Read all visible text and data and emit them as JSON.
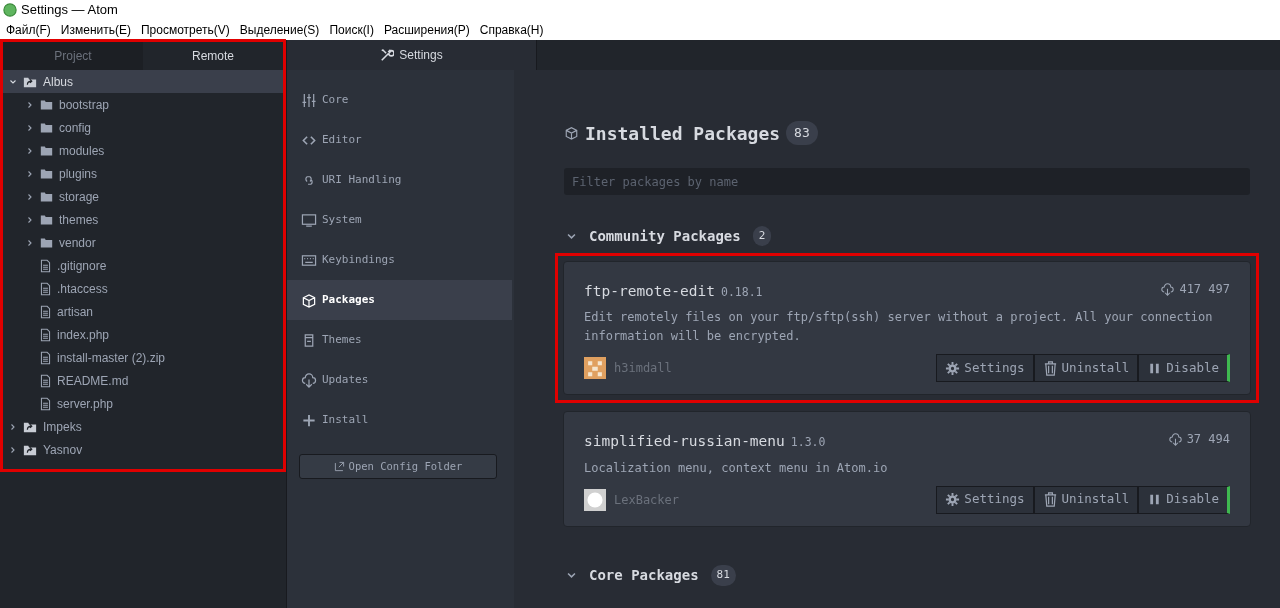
{
  "window": {
    "title": "Settings — Atom"
  },
  "menu": [
    "Файл(F)",
    "Изменить(E)",
    "Просмотреть(V)",
    "Выделение(S)",
    "Поиск(I)",
    "Расширения(P)",
    "Справка(H)"
  ],
  "tree_panel": {
    "highlighted": true,
    "tabs": [
      {
        "label": "Project",
        "selected": false
      },
      {
        "label": "Remote",
        "selected": true
      }
    ],
    "items": [
      {
        "name": "Albus",
        "kind": "project",
        "expanded": true,
        "selected": true,
        "children": [
          {
            "name": "bootstrap",
            "kind": "folder",
            "expanded": false,
            "selected": false
          },
          {
            "name": "config",
            "kind": "folder",
            "expanded": false,
            "selected": false
          },
          {
            "name": "modules",
            "kind": "folder",
            "expanded": false,
            "selected": false
          },
          {
            "name": "plugins",
            "kind": "folder",
            "expanded": false,
            "selected": false
          },
          {
            "name": "storage",
            "kind": "folder",
            "expanded": false,
            "selected": false
          },
          {
            "name": "themes",
            "kind": "folder",
            "expanded": false,
            "selected": false
          },
          {
            "name": "vendor",
            "kind": "folder",
            "expanded": false,
            "selected": false
          },
          {
            "name": ".gitignore",
            "kind": "file",
            "selected": false
          },
          {
            "name": ".htaccess",
            "kind": "file",
            "selected": false
          },
          {
            "name": "artisan",
            "kind": "file",
            "selected": false
          },
          {
            "name": "index.php",
            "kind": "file",
            "selected": false
          },
          {
            "name": "install-master (2).zip",
            "kind": "file",
            "selected": false
          },
          {
            "name": "README.md",
            "kind": "file",
            "selected": false
          },
          {
            "name": "server.php",
            "kind": "file",
            "selected": false
          }
        ]
      },
      {
        "name": "Impeks",
        "kind": "project",
        "expanded": false,
        "selected": false
      },
      {
        "name": "Yasnov",
        "kind": "project",
        "expanded": false,
        "selected": false
      }
    ]
  },
  "editor_tab": {
    "label": "Settings"
  },
  "settings_nav": {
    "items": [
      {
        "label": "Core",
        "selected": false
      },
      {
        "label": "Editor",
        "selected": false
      },
      {
        "label": "URI Handling",
        "selected": false
      },
      {
        "label": "System",
        "selected": false
      },
      {
        "label": "Keybindings",
        "selected": false
      },
      {
        "label": "Packages",
        "selected": true
      },
      {
        "label": "Themes",
        "selected": false
      },
      {
        "label": "Updates",
        "selected": false
      },
      {
        "label": "Install",
        "selected": false
      }
    ],
    "button": "Open Config Folder"
  },
  "installed": {
    "title": "Installed Packages",
    "count": "83",
    "filter_placeholder": "Filter packages by name"
  },
  "sections": [
    {
      "title": "Community Packages",
      "count": "2",
      "expanded": true,
      "packages": [
        {
          "name": "ftp-remote-edit",
          "version": "0.18.1",
          "downloads": "417 497",
          "description": "Edit remotely files on your ftp/sftp(ssh) server without a project. All your connection information will be encrypted.",
          "author": "h3imdall",
          "avatar": {
            "kind": "identicon"
          },
          "highlighted": true,
          "enabled": true,
          "buttons": [
            "Settings",
            "Uninstall",
            "Disable"
          ]
        },
        {
          "name": "simplified-russian-menu",
          "version": "1.3.0",
          "downloads": "37 494",
          "description": "Localization menu, context menu in Atom.io",
          "author": "LexBacker",
          "avatar": {
            "kind": "github"
          },
          "highlighted": false,
          "enabled": true,
          "buttons": [
            "Settings",
            "Uninstall",
            "Disable"
          ]
        }
      ]
    },
    {
      "title": "Core Packages",
      "count": "81",
      "expanded": true
    }
  ]
}
